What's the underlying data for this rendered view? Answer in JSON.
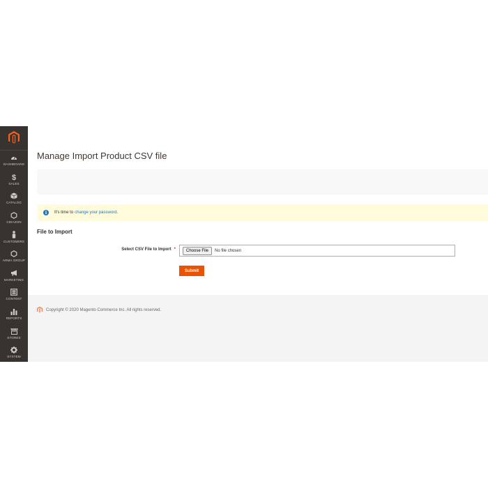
{
  "sidebar": {
    "items": [
      {
        "label": "Dashboard",
        "icon": "dashboard-icon"
      },
      {
        "label": "Sales",
        "icon": "dollar-icon"
      },
      {
        "label": "Catalog",
        "icon": "box-icon"
      },
      {
        "label": "Cdiazon",
        "icon": "hexagon-icon"
      },
      {
        "label": "Customers",
        "icon": "person-icon"
      },
      {
        "label": "Arma Group",
        "icon": "hexagon-icon"
      },
      {
        "label": "Marketing",
        "icon": "megaphone-icon"
      },
      {
        "label": "Content",
        "icon": "layout-icon"
      },
      {
        "label": "Reports",
        "icon": "bar-chart-icon"
      },
      {
        "label": "Stores",
        "icon": "store-icon"
      },
      {
        "label": "System",
        "icon": "gear-icon"
      }
    ]
  },
  "page": {
    "title": "Manage Import Product CSV file"
  },
  "notice": {
    "icon": "info-icon",
    "text": "It's time to",
    "link": "change your password."
  },
  "form": {
    "section_title": "File to Import",
    "field_label": "Select CSV File to Import",
    "required_mark": "*",
    "choose_button": "Choose File",
    "no_file": "No file chosen",
    "submit_label": "Submit"
  },
  "footer": {
    "copyright": "Copyright © 2020 Magento Commerce Inc. All rights reserved."
  },
  "colors": {
    "sidebar_bg": "#373330",
    "accent": "#eb5202",
    "link": "#1979c3",
    "notice_bg": "#fffbdb"
  }
}
